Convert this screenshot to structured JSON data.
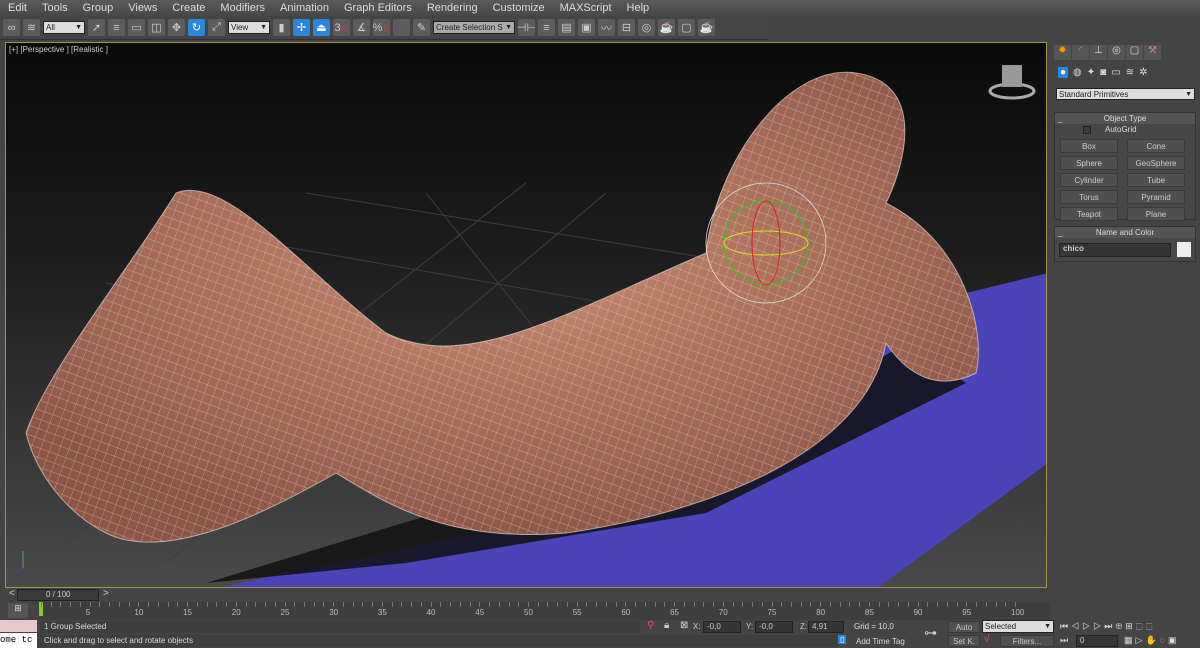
{
  "menu": [
    "Edit",
    "Tools",
    "Group",
    "Views",
    "Create",
    "Modifiers",
    "Animation",
    "Graph Editors",
    "Rendering",
    "Customize",
    "MAXScript",
    "Help"
  ],
  "toolbar": {
    "selection_filter": "All",
    "reference_coord": "View",
    "named_selection": "Create Selection S",
    "snap_3d_label": "3",
    "percent_snap_label": "%"
  },
  "viewport": {
    "label": "[+] [Perspective ] [Realistic ]",
    "plane_color": "#4a44b8",
    "skin_color": "#b57a62"
  },
  "command_panel": {
    "dropdown": "Standard Primitives",
    "object_type_title": "Object Type",
    "autogrid_label": "AutoGrid",
    "autogrid_checked": false,
    "buttons": [
      "Box",
      "Cone",
      "Sphere",
      "GeoSphere",
      "Cylinder",
      "Tube",
      "Torus",
      "Pyramid",
      "Teapot",
      "Plane"
    ],
    "name_color_title": "Name and Color",
    "object_name": "chico",
    "object_color": "#eeeeee",
    "collapse": "_"
  },
  "timeline": {
    "frame_display": "0 / 100",
    "prev": "<",
    "next": ">",
    "current_frame": 0,
    "ticks": [
      "5",
      "10",
      "15",
      "20",
      "25",
      "30",
      "35",
      "40",
      "45",
      "50",
      "55",
      "60",
      "65",
      "70",
      "75",
      "80",
      "85",
      "90",
      "95",
      "100"
    ]
  },
  "status": {
    "listener_text": "ome tc",
    "selection_status": "1 Group Selected",
    "prompt": "Click and drag to select and rotate objects",
    "x_label": "X:",
    "x_value": "-0,0",
    "y_label": "Y:",
    "y_value": "-0,0",
    "z_label": "Z:",
    "z_value": "4,91",
    "grid": "Grid = 10,0",
    "add_time_tag": "Add Time Tag",
    "auto": "Auto",
    "set_key": "Set K.",
    "key_filter": "Selected",
    "filters": "Filters...",
    "frame_field": "0"
  }
}
